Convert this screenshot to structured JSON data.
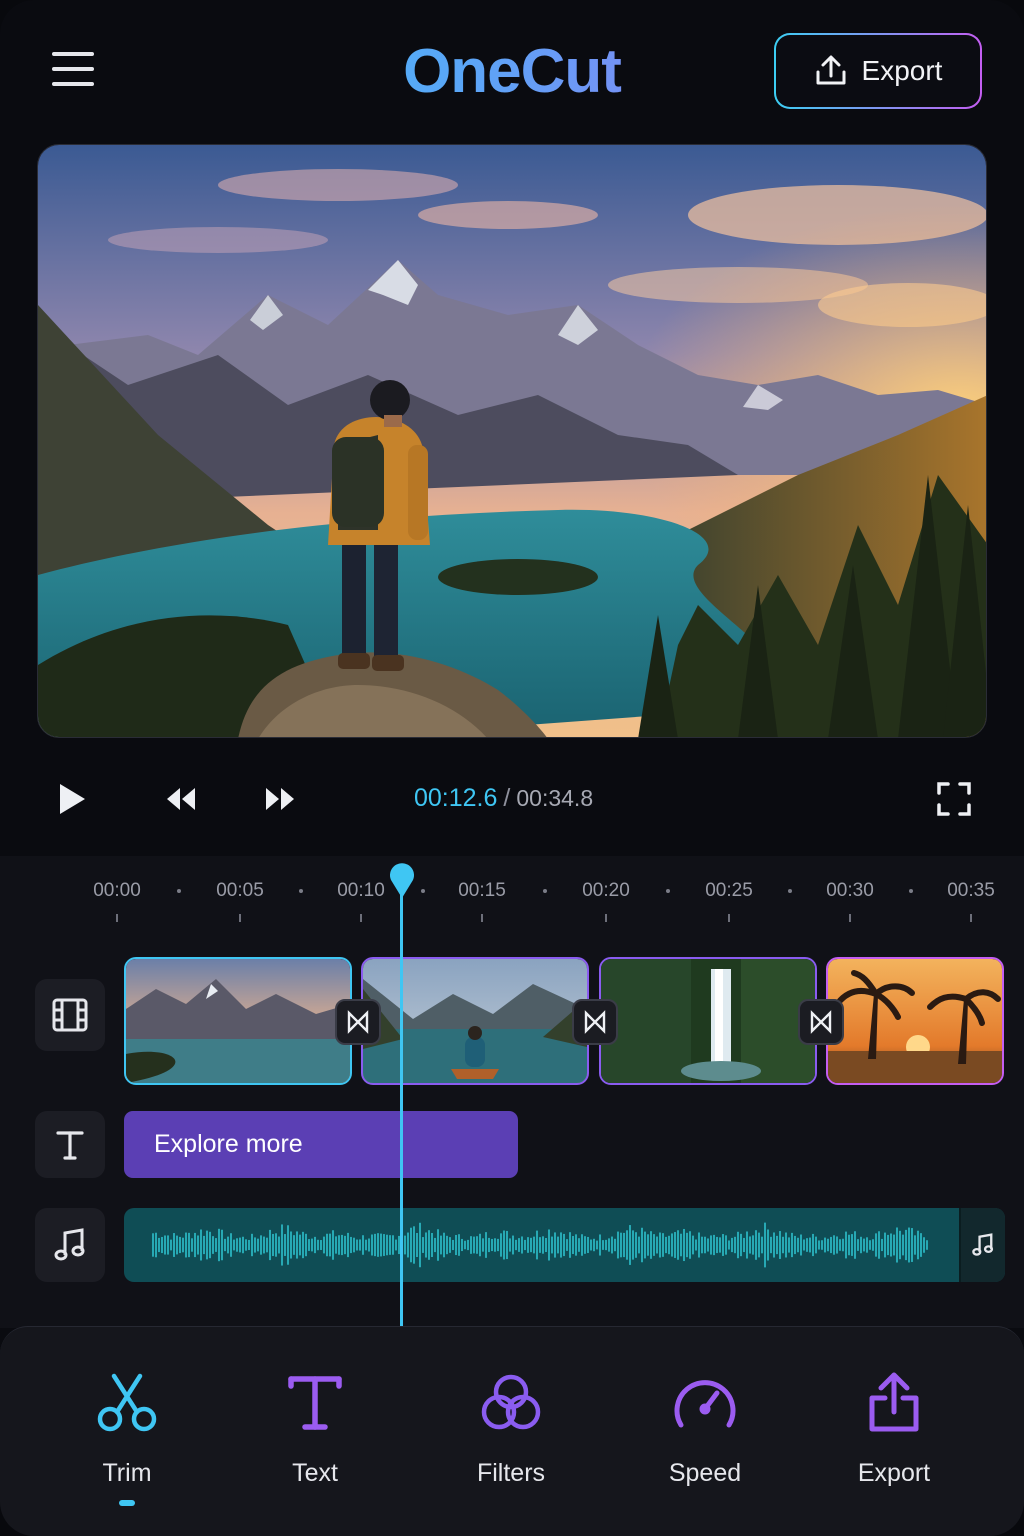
{
  "header": {
    "app_title": "OneCut",
    "export_label": "Export"
  },
  "playback": {
    "current_time": "00:12.6",
    "separator": "/",
    "total_time": "00:34.8"
  },
  "timeline": {
    "ruler": [
      "00:00",
      "00:05",
      "00:10",
      "00:15",
      "00:20",
      "00:25",
      "00:30",
      "00:35"
    ],
    "playhead_position_seconds": 12.6,
    "text_clip_label": "Explore more",
    "video_clips": [
      "mountains-sunset",
      "lake-kayak",
      "forest-waterfall",
      "beach-palms-sunset"
    ]
  },
  "toolbar": {
    "tools": [
      {
        "label": "Trim",
        "icon": "scissors-icon",
        "active": true
      },
      {
        "label": "Text",
        "icon": "text-icon",
        "active": false
      },
      {
        "label": "Filters",
        "icon": "filters-icon",
        "active": false
      },
      {
        "label": "Speed",
        "icon": "speedometer-icon",
        "active": false
      },
      {
        "label": "Export",
        "icon": "share-icon",
        "active": false
      }
    ]
  },
  "colors": {
    "accent_cyan": "#3fc6f3",
    "accent_purple": "#a855f7",
    "text_clip": "#5b3fb4",
    "audio_clip": "#0f4d55"
  }
}
